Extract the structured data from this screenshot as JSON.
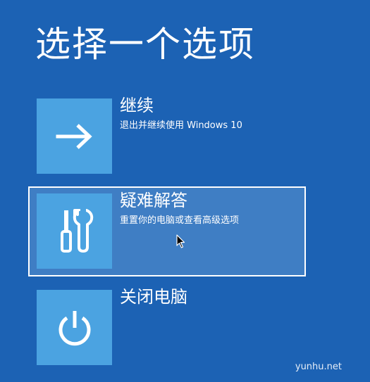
{
  "page": {
    "title": "选择一个选项"
  },
  "options": [
    {
      "id": "continue",
      "title": "继续",
      "description": "退出并继续使用 Windows 10",
      "icon": "arrow-right-icon",
      "selected": false
    },
    {
      "id": "troubleshoot",
      "title": "疑难解答",
      "description": "重置你的电脑或查看高级选项",
      "icon": "tools-icon",
      "selected": true
    },
    {
      "id": "shutdown",
      "title": "关闭电脑",
      "description": "",
      "icon": "power-icon",
      "selected": false
    }
  ],
  "watermark": "yunhu.net",
  "colors": {
    "background": "#1c62b4",
    "tile": "#4ba3e1",
    "selected_background": "#3f7ec4",
    "text": "#ffffff"
  }
}
